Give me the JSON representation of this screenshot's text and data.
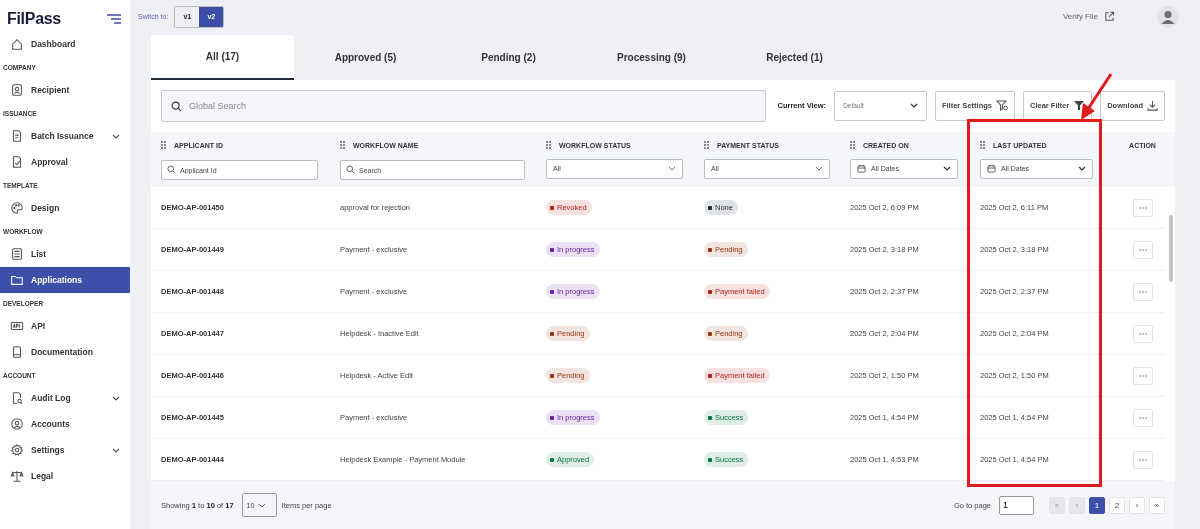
{
  "brand": {
    "name": "FilPass"
  },
  "sidebar": {
    "items": [
      {
        "kind": "link",
        "label": "Dashboard",
        "selected": false,
        "expandable": false
      },
      {
        "kind": "section",
        "label": "COMPANY"
      },
      {
        "kind": "link",
        "label": "Recipient",
        "selected": false,
        "expandable": false
      },
      {
        "kind": "section",
        "label": "ISSUANCE"
      },
      {
        "kind": "link",
        "label": "Batch Issuance",
        "selected": false,
        "expandable": true
      },
      {
        "kind": "link",
        "label": "Approval",
        "selected": false,
        "expandable": false
      },
      {
        "kind": "section",
        "label": "TEMPLATE"
      },
      {
        "kind": "link",
        "label": "Design",
        "selected": false,
        "expandable": false
      },
      {
        "kind": "section",
        "label": "WORKFLOW"
      },
      {
        "kind": "link",
        "label": "List",
        "selected": false,
        "expandable": false
      },
      {
        "kind": "link",
        "label": "Applications",
        "selected": true,
        "expandable": false
      },
      {
        "kind": "section",
        "label": "DEVELOPER"
      },
      {
        "kind": "link",
        "label": "API",
        "selected": false,
        "expandable": false
      },
      {
        "kind": "link",
        "label": "Documentation",
        "selected": false,
        "expandable": false
      },
      {
        "kind": "section",
        "label": "ACCOUNT"
      },
      {
        "kind": "link",
        "label": "Audit Log",
        "selected": false,
        "expandable": true
      },
      {
        "kind": "link",
        "label": "Accounts",
        "selected": false,
        "expandable": false
      },
      {
        "kind": "link",
        "label": "Settings",
        "selected": false,
        "expandable": true
      },
      {
        "kind": "link",
        "label": "Legal",
        "selected": false,
        "expandable": false
      }
    ]
  },
  "topbar": {
    "switch_label": "Switch to:",
    "versions": [
      {
        "label": "v1",
        "selected": false
      },
      {
        "label": "v2",
        "selected": true
      }
    ],
    "verify_link": "Verify File"
  },
  "tabs": [
    {
      "label": "All (17)",
      "selected": true
    },
    {
      "label": "Approved (5)",
      "selected": false
    },
    {
      "label": "Pending (2)",
      "selected": false
    },
    {
      "label": "Processing (9)",
      "selected": false
    },
    {
      "label": "Rejected (1)",
      "selected": false
    }
  ],
  "toolbar": {
    "search": {
      "placeholder": "Global Search"
    },
    "view_label": "Current View:",
    "view": {
      "value": "Default"
    },
    "buttons": [
      {
        "label": "Filter Settings",
        "kind": "filter-settings"
      },
      {
        "label": "Clear Filter",
        "kind": "clear-filter"
      },
      {
        "label": "Download",
        "kind": "download"
      }
    ]
  },
  "table": {
    "columns": [
      {
        "label": "APPLICANT ID",
        "draggable": true,
        "filter": {
          "kind": "search",
          "placeholder": "Applicant Id"
        }
      },
      {
        "label": "WORKFLOW NAME",
        "draggable": true,
        "filter": {
          "kind": "search",
          "placeholder": "Search"
        }
      },
      {
        "label": "WORKFLOW STATUS",
        "draggable": true,
        "filter": {
          "kind": "select",
          "value": "All"
        }
      },
      {
        "label": "PAYMENT STATUS",
        "draggable": true,
        "filter": {
          "kind": "select",
          "value": "All"
        }
      },
      {
        "label": "CREATED ON",
        "draggable": true,
        "filter": {
          "kind": "date",
          "value": "All Dates"
        }
      },
      {
        "label": "LAST UPDATED",
        "draggable": true,
        "filter": {
          "kind": "date",
          "value": "All Dates"
        }
      },
      {
        "label": "ACTION",
        "draggable": false
      }
    ],
    "rows": [
      {
        "id": "DEMO-AP-001450",
        "workflow": "approval for rejection",
        "workflow_status": {
          "label": "Revoked",
          "color": "#b42318"
        },
        "payment_status": {
          "label": "None",
          "color": "#1f2937"
        },
        "created": "2025 Oct 2, 6:09 PM",
        "updated": "2025 Oct 2, 6:11 PM"
      },
      {
        "id": "DEMO-AP-001449",
        "workflow": "Payment - exclusive",
        "workflow_status": {
          "label": "In progress",
          "color": "#6b21a8"
        },
        "payment_status": {
          "label": "Pending",
          "color": "#9a3412"
        },
        "created": "2025 Oct 2, 3:18 PM",
        "updated": "2025 Oct 2, 3:18 PM"
      },
      {
        "id": "DEMO-AP-001448",
        "workflow": "Payment - exclusive",
        "workflow_status": {
          "label": "In progress",
          "color": "#6b21a8"
        },
        "payment_status": {
          "label": "Payment failed",
          "color": "#b42318"
        },
        "created": "2025 Oct 2, 2:37 PM",
        "updated": "2025 Oct 2, 2:37 PM"
      },
      {
        "id": "DEMO-AP-001447",
        "workflow": "Helpdesk - Inactive Edit",
        "workflow_status": {
          "label": "Pending",
          "color": "#9a3412"
        },
        "payment_status": {
          "label": "Pending",
          "color": "#9a3412"
        },
        "created": "2025 Oct 2, 2:04 PM",
        "updated": "2025 Oct 2, 2:04 PM"
      },
      {
        "id": "DEMO-AP-001446",
        "workflow": "Helpdesk - Active Edit",
        "workflow_status": {
          "label": "Pending",
          "color": "#9a3412"
        },
        "payment_status": {
          "label": "Payment failed",
          "color": "#b42318"
        },
        "created": "2025 Oct 2, 1:50 PM",
        "updated": "2025 Oct 2, 1:50 PM"
      },
      {
        "id": "DEMO-AP-001445",
        "workflow": "Payment - exclusive",
        "workflow_status": {
          "label": "In progress",
          "color": "#6b21a8"
        },
        "payment_status": {
          "label": "Success",
          "color": "#067647"
        },
        "created": "2025 Oct 1, 4:54 PM",
        "updated": "2025 Oct 1, 4:54 PM"
      },
      {
        "id": "DEMO-AP-001444",
        "workflow": "Helpdesk Example - Payment Module",
        "workflow_status": {
          "label": "Approved",
          "color": "#067647"
        },
        "payment_status": {
          "label": "Success",
          "color": "#067647"
        },
        "created": "2025 Oct 1, 4:53 PM",
        "updated": "2025 Oct 1, 4:54 PM"
      }
    ]
  },
  "footer": {
    "showing": "Showing **1** to **10** of **17**",
    "per_page": {
      "value": "10"
    },
    "per_page_label": "Items per page",
    "goto_label": "Go to page",
    "goto": {
      "value": "1"
    },
    "pages": [
      {
        "label": "«",
        "disabled": true,
        "selected": false
      },
      {
        "label": "‹",
        "disabled": true,
        "selected": false
      },
      {
        "label": "1",
        "disabled": false,
        "selected": true
      },
      {
        "label": "2",
        "disabled": false,
        "selected": false
      },
      {
        "label": "›",
        "disabled": false,
        "selected": false
      },
      {
        "label": "»",
        "disabled": false,
        "selected": false
      }
    ]
  },
  "annotations": [
    {
      "kind": "box"
    },
    {
      "kind": "arrow"
    }
  ]
}
